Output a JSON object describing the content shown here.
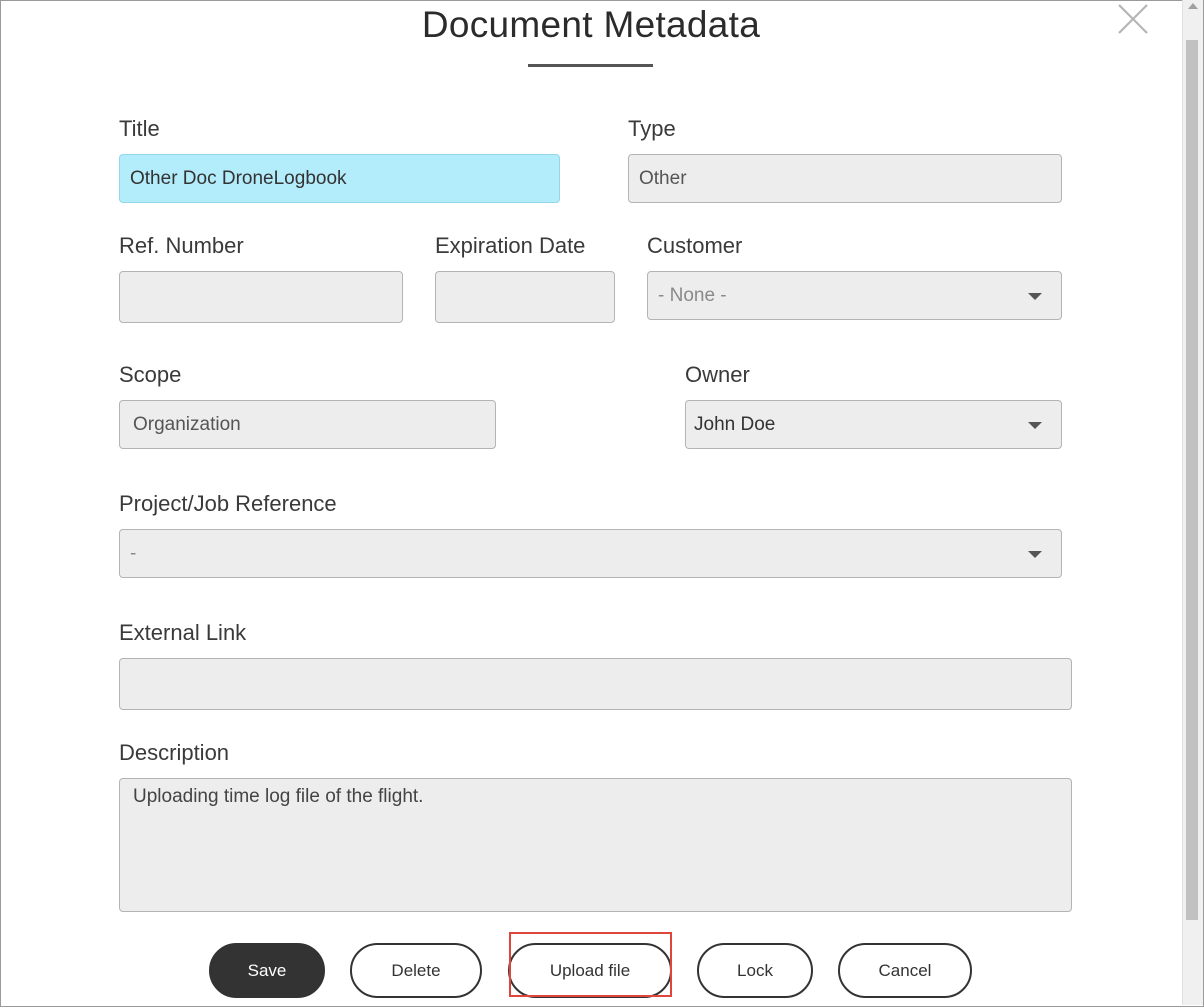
{
  "dialog": {
    "title": "Document Metadata"
  },
  "fields": {
    "title": {
      "label": "Title",
      "value": "Other Doc DroneLogbook"
    },
    "type": {
      "label": "Type",
      "value": "Other"
    },
    "ref_number": {
      "label": "Ref. Number",
      "value": ""
    },
    "expiration_date": {
      "label": "Expiration Date",
      "value": ""
    },
    "customer": {
      "label": "Customer",
      "value": "- None -"
    },
    "scope": {
      "label": "Scope",
      "value": "Organization"
    },
    "owner": {
      "label": "Owner",
      "value": "John Doe"
    },
    "project": {
      "label": "Project/Job Reference",
      "value": "-"
    },
    "external_link": {
      "label": "External Link",
      "value": ""
    },
    "description": {
      "label": "Description",
      "value": "Uploading time log file of the flight."
    }
  },
  "buttons": {
    "save": "Save",
    "delete": "Delete",
    "upload": "Upload file",
    "lock": "Lock",
    "cancel": "Cancel"
  },
  "colors": {
    "title_field_bg": "#b3ecfb",
    "highlight_border": "#e0453c",
    "primary_button": "#333333"
  }
}
